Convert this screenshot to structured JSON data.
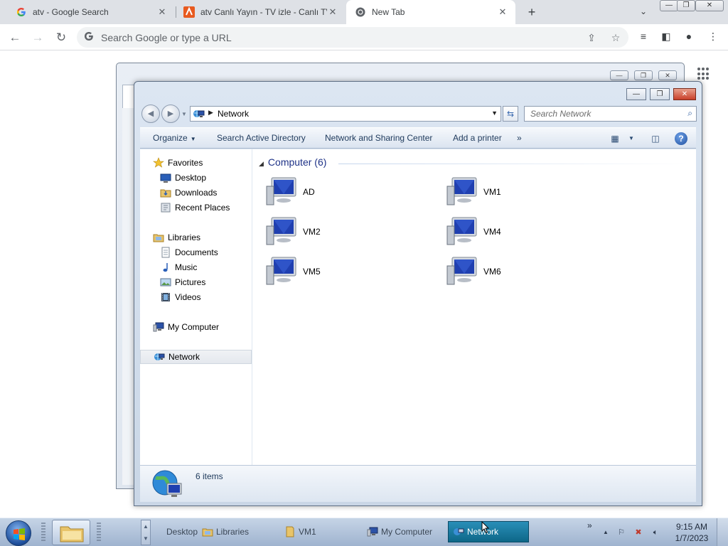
{
  "browser": {
    "tabs": [
      {
        "title": "atv - Google Search",
        "icon": "google-g-icon"
      },
      {
        "title": "atv Canlı Yayın - TV izle - Canlı TV",
        "icon": "atv-favicon"
      },
      {
        "title": "New Tab",
        "icon": "chrome-icon"
      }
    ],
    "omnibox_placeholder": "Search Google or type a URL"
  },
  "explorer": {
    "address": "Network",
    "search_placeholder": "Search Network",
    "commands": {
      "organize": "Organize",
      "search_ad": "Search Active Directory",
      "sharing_center": "Network and Sharing Center",
      "add_printer": "Add a printer",
      "more": "»"
    },
    "nav": {
      "favorites": "Favorites",
      "desktop": "Desktop",
      "downloads": "Downloads",
      "recent": "Recent Places",
      "libraries": "Libraries",
      "documents": "Documents",
      "music": "Music",
      "pictures": "Pictures",
      "videos": "Videos",
      "my_computer": "My Computer",
      "network": "Network"
    },
    "group_header": "Computer (6)",
    "computers": [
      "AD",
      "VM1",
      "VM2",
      "VM4",
      "VM5",
      "VM6"
    ],
    "item_count": "6 items"
  },
  "taskbar": {
    "desktop_label": "Desktop",
    "items": {
      "libraries": "Libraries",
      "vm1": "VM1",
      "my_computer": "My Computer",
      "network": "Network"
    },
    "more": "»",
    "time": "9:15 AM",
    "date": "1/7/2023"
  }
}
